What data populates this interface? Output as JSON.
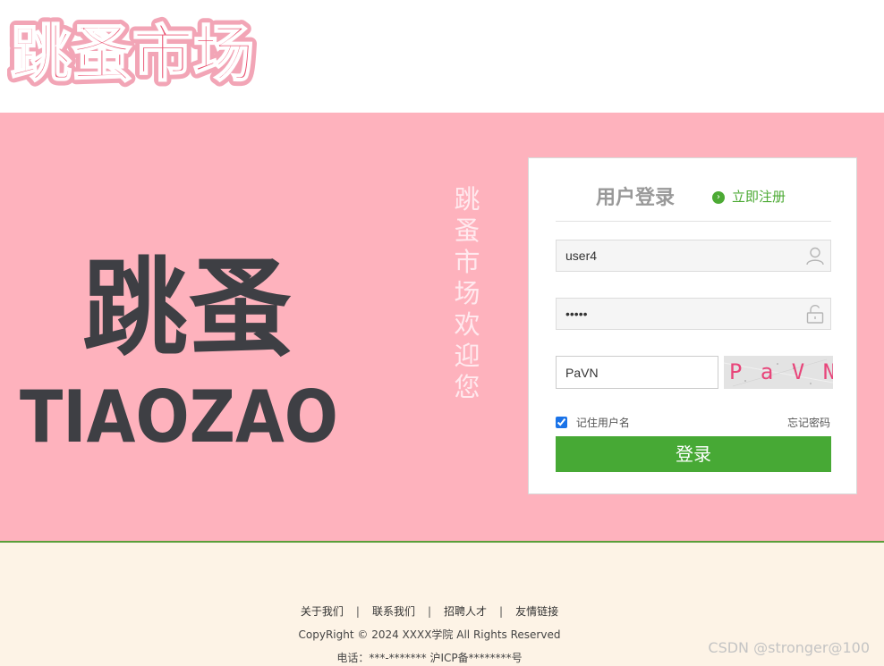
{
  "header": {
    "logo_text": "跳蚤市场"
  },
  "hero": {
    "brand_cn": "跳蚤",
    "brand_en": "TIAOZAO",
    "welcome_chars": [
      "跳",
      "蚤",
      "市",
      "场",
      "欢",
      "迎",
      "您"
    ]
  },
  "login": {
    "title": "用户登录",
    "register_label": "立即注册",
    "username_value": "user4",
    "password_value": "•••••",
    "captcha_value": "PaVN",
    "captcha_image_text": "P a V N",
    "remember_label": "记住用户名",
    "remember_checked": true,
    "forgot_label": "忘记密码",
    "submit_label": "登录",
    "icons": {
      "user": "user-icon",
      "lock": "lock-icon",
      "register": "chevron-right-icon"
    }
  },
  "footer": {
    "links": [
      "关于我们",
      "联系我们",
      "招聘人才",
      "友情链接"
    ],
    "separator": "|",
    "copyright": "CopyRight © 2024 XXXX学院 All Rights Reserved",
    "phone": "电话：***-******* 沪ICP备********号",
    "watermark": "CSDN @stronger@100"
  },
  "colors": {
    "hero_bg": "#feb2bd",
    "accent_green": "#47a935",
    "footer_bg": "#fdf3e6",
    "logo_pink": "#e94f6f"
  }
}
